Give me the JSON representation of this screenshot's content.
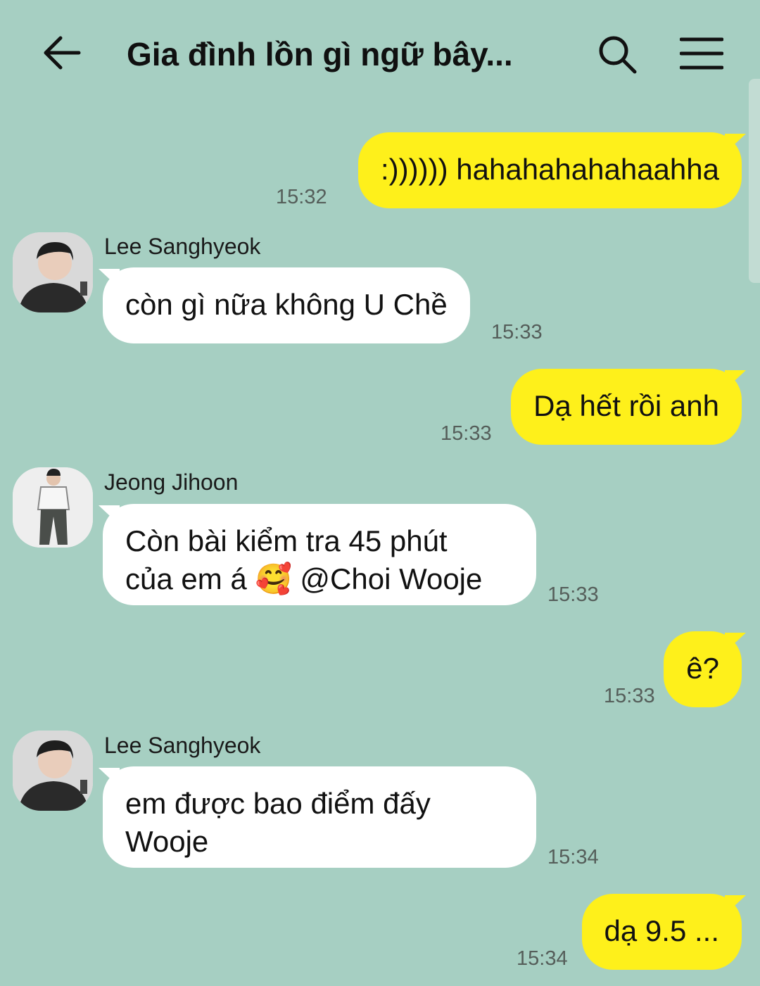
{
  "header": {
    "title": "Gia đình lồn gì ngữ bây...",
    "back_icon": "arrow-left-icon",
    "search_icon": "search-icon",
    "menu_icon": "hamburger-menu-icon"
  },
  "colors": {
    "background": "#a6cfc2",
    "my_bubble": "#fef01b",
    "their_bubble": "#ffffff"
  },
  "messages": [
    {
      "from": "me",
      "text": ":)))))) hahahahahahaahha",
      "time": "15:32"
    },
    {
      "from": "Lee Sanghyeok",
      "sender": "Lee Sanghyeok",
      "text": "còn gì nữa không U Chề",
      "time": "15:33"
    },
    {
      "from": "me",
      "text": "Dạ hết rồi anh",
      "time": "15:33"
    },
    {
      "from": "Jeong Jihoon",
      "sender": "Jeong Jihoon",
      "line1": "Còn bài kiểm tra 45 phút",
      "line2_pre": "của em á ",
      "emoji": "🥰",
      "line2_post": " @Choi Wooje",
      "time": "15:33"
    },
    {
      "from": "me",
      "text": "ê?",
      "time": "15:33"
    },
    {
      "from": "Lee Sanghyeok",
      "sender": "Lee Sanghyeok",
      "line1": "em được bao điểm đấy",
      "line2": "Wooje",
      "time": "15:34"
    },
    {
      "from": "me",
      "text": "dạ 9.5 ...",
      "time": "15:34"
    }
  ]
}
